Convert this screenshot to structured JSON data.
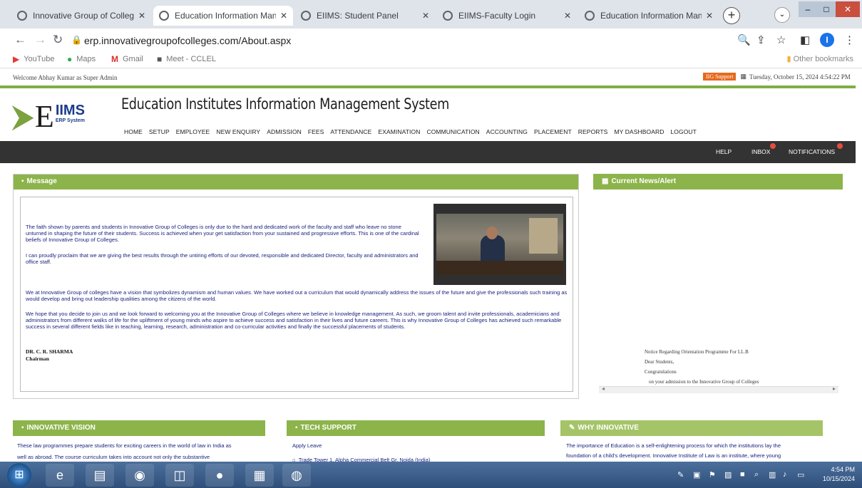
{
  "browser": {
    "tabs": [
      {
        "title": "Innovative Group of Colleges",
        "active": false
      },
      {
        "title": "Education Information Mana",
        "active": true
      },
      {
        "title": "EIIMS: Student Panel",
        "active": false
      },
      {
        "title": "EIIMS-Faculty Login",
        "active": false
      },
      {
        "title": "Education Information Manac",
        "active": false
      }
    ],
    "url": "erp.innovativegroupofcolleges.com/About.aspx",
    "bookmarks": [
      "YouTube",
      "Maps",
      "Gmail",
      "Meet - CCLEL"
    ],
    "other_bookmarks": "Other bookmarks",
    "avatar_letter": "I"
  },
  "page": {
    "welcome": "Welcome Abhay Kumar as Super Admin",
    "support_badge": "IIG Support",
    "datetime": "Tuesday, October 15, 2024 4:54:22 PM",
    "logo_letter": "E",
    "logo_name": "IIMS",
    "logo_sub": "ERP System",
    "system_title": "Education Institutes Information Management System",
    "menu": [
      "HOME",
      "SETUP",
      "EMPLOYEE",
      "NEW ENQUIRY",
      "ADMISSION",
      "FEES",
      "ATTENDANCE",
      "EXAMINATION",
      "COMMUNICATION",
      "ACCOUNTING",
      "PLACEMENT",
      "REPORTS",
      "MY DASHBOARD",
      "LOGOUT"
    ],
    "topbar": {
      "help": "HELP",
      "inbox": "INBOX",
      "notifications": "NOTIFICATIONS"
    },
    "message": {
      "heading": "Message",
      "p1": "The faith shown by parents and students in Innovative Group of Colleges is only due to the hard and dedicated work of the faculty and staff who leave no stone unturned in shaping the future of their students. Success is achieved when your get satisfaction from your sustained and progressive efforts. This is one of the cardinal beliefs of Innovative Group of Colleges.",
      "p2": "I can proudly proclaim that we are giving the best results through the untiring efforts of our devoted, responsible and dedicated Director, faculty and administrators and office staff.",
      "p3": "We at Innovative Group of colleges have a vision that symbolizes dynamism and human values. We have worked out a curriculum that would dynamically address the issues of the future and give the professionals such training as would develop and bring out leadership qualities among the citizens of the world.",
      "p4": "We hope that you decide to join us and we look forward to welcoming you at the Innovative Group of Colleges where we believe in knowledge management. As such, we groom talent and invite professionals, academicians and administrators from different walks of life for the upliftment of young minds who aspire to achieve success and satisfaction in their lives and future careers. This is why Innovative Group of Colleges has achieved such remarkable success in several different fields like in teaching, learning, research, administration and co-curricular activities and finally the successful placements of students.",
      "signatory": "DR. C. R. SHARMA",
      "designation": "Chairman"
    },
    "news": {
      "heading": "Current News/Alert",
      "lines": [
        "Notice Regarding Orientation Programme For LL.B",
        "Dear Students,",
        "Congratulations",
        "on your admission to the Innovative Group of Colleges"
      ]
    },
    "vision": {
      "heading": "INNOVATIVE VISION",
      "line1": "These law programmes prepare students for exciting careers in the world of law in India as",
      "line2": "well as abroad. The course curriculum takes into account not only the substantive"
    },
    "tech": {
      "heading": "TECH SUPPORT",
      "apply": "Apply Leave",
      "address": "Trade Tower 1, Alpha Commercial Belt Gr. Noida (India)"
    },
    "why": {
      "heading": "WHY INNOVATIVE",
      "line1": "The importance of Education is a self-enlightening process for which the institutions lay the",
      "line2": "foundation of a child's development. Innovative Institute of Law is an institute, where young"
    }
  },
  "taskbar": {
    "time": "4:54 PM",
    "date": "10/15/2024"
  }
}
